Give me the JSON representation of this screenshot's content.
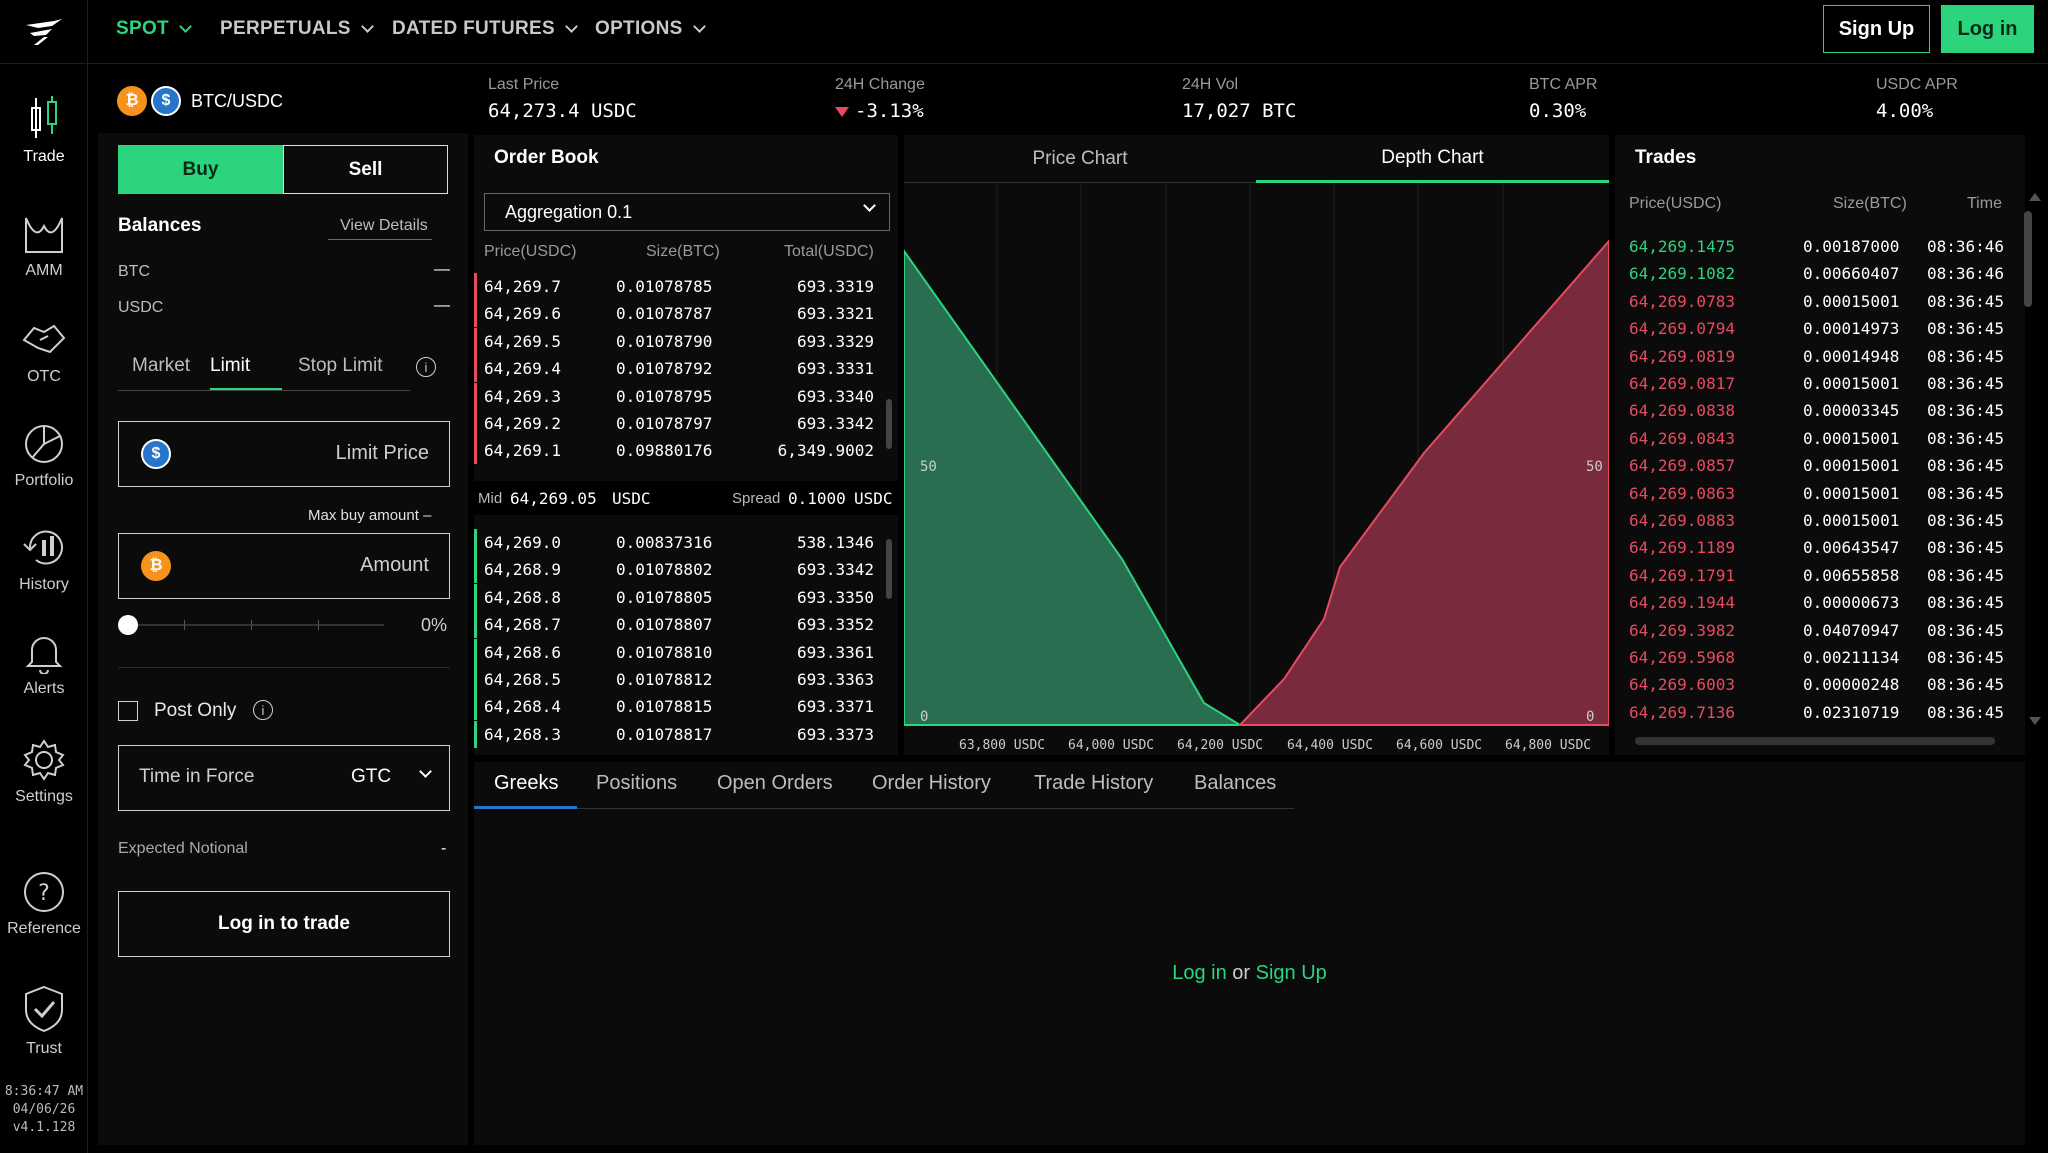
{
  "nav": {
    "items": [
      {
        "label": "SPOT",
        "active": true
      },
      {
        "label": "PERPETUALS"
      },
      {
        "label": "DATED FUTURES"
      },
      {
        "label": "OPTIONS"
      }
    ],
    "signup": "Sign Up",
    "login": "Log in"
  },
  "rail": {
    "items": [
      "Trade",
      "AMM",
      "OTC",
      "Portfolio",
      "History",
      "Alerts",
      "Settings",
      "Reference",
      "Trust"
    ],
    "time": "8:36:47 AM",
    "date": "04/06/26",
    "version": "v4.1.128"
  },
  "ticker": {
    "pair": "BTC/USDC",
    "last_price_label": "Last Price",
    "last_price": "64,273.4 USDC",
    "change_label": "24H Change",
    "change": "-3.13%",
    "vol_label": "24H Vol",
    "vol": "17,027 BTC",
    "btc_apr_label": "BTC APR",
    "btc_apr": "0.30%",
    "usdc_apr_label": "USDC APR",
    "usdc_apr": "4.00%"
  },
  "order": {
    "buy": "Buy",
    "sell": "Sell",
    "balances": "Balances",
    "view_details": "View Details",
    "btc": "BTC",
    "btc_val": "—",
    "usdc": "USDC",
    "usdc_val": "—",
    "tabs": [
      "Market",
      "Limit",
      "Stop Limit"
    ],
    "limit_price": "Limit Price",
    "max_buy": "Max buy amount",
    "max_buy_val": "–",
    "amount": "Amount",
    "slider_pct": "0%",
    "post_only": "Post Only",
    "tif_label": "Time in Force",
    "tif_value": "GTC",
    "expected_notional": "Expected Notional",
    "expected_val": "-",
    "login_trade": "Log in to trade"
  },
  "orderbook": {
    "title": "Order Book",
    "aggregation": "Aggregation 0.1",
    "headers": [
      "Price(USDC)",
      "Size(BTC)",
      "Total(USDC)"
    ],
    "asks": [
      [
        "64,269.7",
        "0.01078785",
        "693.3319"
      ],
      [
        "64,269.6",
        "0.01078787",
        "693.3321"
      ],
      [
        "64,269.5",
        "0.01078790",
        "693.3329"
      ],
      [
        "64,269.4",
        "0.01078792",
        "693.3331"
      ],
      [
        "64,269.3",
        "0.01078795",
        "693.3340"
      ],
      [
        "64,269.2",
        "0.01078797",
        "693.3342"
      ],
      [
        "64,269.1",
        "0.09880176",
        "6,349.9002"
      ]
    ],
    "mid_label": "Mid",
    "mid": "64,269.05",
    "mid_unit": "USDC",
    "spread_label": "Spread",
    "spread": "0.1000",
    "spread_unit": "USDC",
    "bids": [
      [
        "64,269.0",
        "0.00837316",
        "538.1346"
      ],
      [
        "64,268.9",
        "0.01078802",
        "693.3342"
      ],
      [
        "64,268.8",
        "0.01078805",
        "693.3350"
      ],
      [
        "64,268.7",
        "0.01078807",
        "693.3352"
      ],
      [
        "64,268.6",
        "0.01078810",
        "693.3361"
      ],
      [
        "64,268.5",
        "0.01078812",
        "693.3363"
      ],
      [
        "64,268.4",
        "0.01078815",
        "693.3371"
      ],
      [
        "64,268.3",
        "0.01078817",
        "693.3373"
      ]
    ]
  },
  "chart": {
    "tabs": [
      "Price Chart",
      "Depth Chart"
    ],
    "active_tab": "Depth Chart",
    "y_left": [
      "50",
      "0"
    ],
    "y_right": [
      "50",
      "0"
    ],
    "x_ticks": [
      "63,800 USDC",
      "64,000 USDC",
      "64,200 USDC",
      "64,400 USDC",
      "64,600 USDC",
      "64,800 USDC"
    ],
    "bid_color": "#2a6e52",
    "ask_color": "#7a2a3d"
  },
  "trades": {
    "title": "Trades",
    "headers": [
      "Price(USDC)",
      "Size(BTC)",
      "Time"
    ],
    "rows": [
      [
        "64,269.1475",
        "0.00187000",
        "08:36:46",
        "buy"
      ],
      [
        "64,269.1082",
        "0.00660407",
        "08:36:46",
        "buy"
      ],
      [
        "64,269.0783",
        "0.00015001",
        "08:36:45",
        "sell"
      ],
      [
        "64,269.0794",
        "0.00014973",
        "08:36:45",
        "sell"
      ],
      [
        "64,269.0819",
        "0.00014948",
        "08:36:45",
        "sell"
      ],
      [
        "64,269.0817",
        "0.00015001",
        "08:36:45",
        "sell"
      ],
      [
        "64,269.0838",
        "0.00003345",
        "08:36:45",
        "sell"
      ],
      [
        "64,269.0843",
        "0.00015001",
        "08:36:45",
        "sell"
      ],
      [
        "64,269.0857",
        "0.00015001",
        "08:36:45",
        "sell"
      ],
      [
        "64,269.0863",
        "0.00015001",
        "08:36:45",
        "sell"
      ],
      [
        "64,269.0883",
        "0.00015001",
        "08:36:45",
        "sell"
      ],
      [
        "64,269.1189",
        "0.00643547",
        "08:36:45",
        "sell"
      ],
      [
        "64,269.1791",
        "0.00655858",
        "08:36:45",
        "sell"
      ],
      [
        "64,269.1944",
        "0.00000673",
        "08:36:45",
        "sell"
      ],
      [
        "64,269.3982",
        "0.04070947",
        "08:36:45",
        "sell"
      ],
      [
        "64,269.5968",
        "0.00211134",
        "08:36:45",
        "sell"
      ],
      [
        "64,269.6003",
        "0.00000248",
        "08:36:45",
        "sell"
      ],
      [
        "64,269.7136",
        "0.02310719",
        "08:36:45",
        "sell"
      ]
    ]
  },
  "bottom": {
    "tabs": [
      "Greeks",
      "Positions",
      "Open Orders",
      "Order History",
      "Trade History",
      "Balances"
    ],
    "login": "Log in",
    "or": "or",
    "signup": "Sign Up"
  },
  "colors": {
    "accent": "#2bd47d",
    "sell": "#e84a5f",
    "buy": "#2bd47d"
  }
}
